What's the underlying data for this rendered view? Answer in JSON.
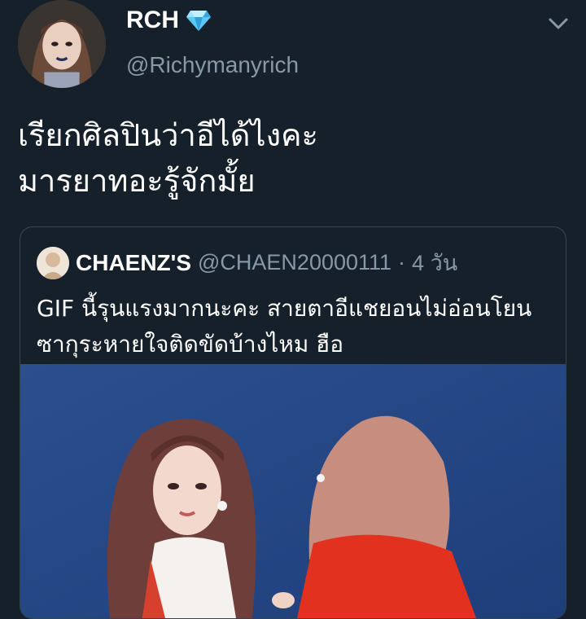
{
  "tweet": {
    "display_name": "RCH",
    "verified_icon": "diamond-icon",
    "handle": "@Richymanyrich",
    "text_line1": "เรียกศิลปินว่าอีได้ไงคะ",
    "text_line2": "มารยาทอะรู้จักมั้ย"
  },
  "quoted_tweet": {
    "display_name": "CHAENZ'S",
    "handle": "@CHAEN20000111",
    "separator": "·",
    "time": "4 วัน",
    "text_line1": "GIF นี้รุนแรงมากนะคะ สายตาอีแชยอนไม่อ่อนโยน",
    "text_line2": "ซากุระหายใจติดขัดบ้างไหม ฮือ"
  },
  "colors": {
    "background": "#15202b",
    "secondary_text": "#8899a6",
    "border": "#38444d",
    "diamond": "#5ac8fa"
  }
}
